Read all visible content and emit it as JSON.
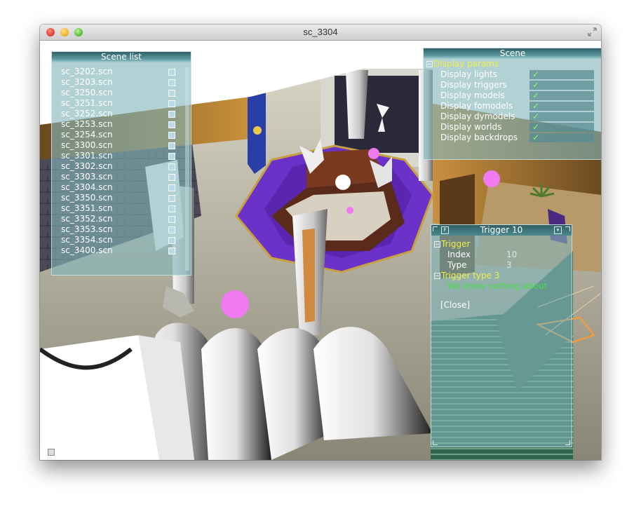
{
  "window": {
    "title": "sc_3304"
  },
  "scene_list": {
    "title": "Scene list",
    "items": [
      "sc_3202.scn",
      "sc_3203.scn",
      "sc_3250.scn",
      "sc_3251.scn",
      "sc_3252.scn",
      "sc_3253.scn",
      "sc_3254.scn",
      "sc_3300.scn",
      "sc_3301.scn",
      "sc_3302.scn",
      "sc_3303.scn",
      "sc_3304.scn",
      "sc_3350.scn",
      "sc_3351.scn",
      "sc_3352.scn",
      "sc_3353.scn",
      "sc_3354.scn",
      "sc_3400.scn"
    ]
  },
  "scene_panel": {
    "title": "Scene",
    "group": "Display params",
    "params": [
      {
        "label": "Display lights",
        "checked": true
      },
      {
        "label": "Display triggers",
        "checked": true
      },
      {
        "label": "Display models",
        "checked": true
      },
      {
        "label": "Display fomodels",
        "checked": true
      },
      {
        "label": "Display dymodels",
        "checked": true
      },
      {
        "label": "Display worlds",
        "checked": true
      },
      {
        "label": "Display backdrops",
        "checked": true
      }
    ]
  },
  "trigger_panel": {
    "title": "Trigger 10",
    "group": "Trigger",
    "index_label": "Index",
    "index_value": "10",
    "type_label": "Type",
    "type_value": "3",
    "type_group": "Trigger type 3",
    "description": "We know nothing about",
    "close_label": "[Close]"
  },
  "icons": {
    "check": "checkmark-icon",
    "expand": "minus-box-icon"
  },
  "colors": {
    "panel_text": "#ffffff",
    "group_text": "#f0f04a",
    "check": "#8cff6a",
    "description": "#46e046",
    "carpet": "#6a32c8",
    "trigger_sphere": "#f07af0"
  }
}
